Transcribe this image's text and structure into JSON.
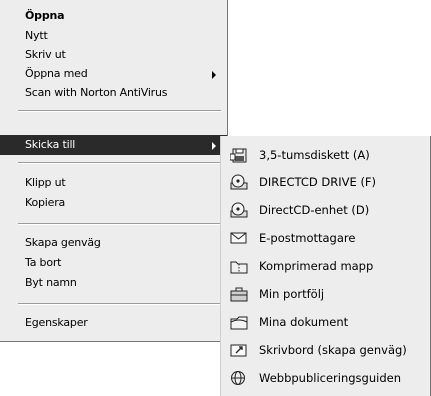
{
  "context_menu": {
    "items": [
      {
        "label": "Öppna"
      },
      {
        "label": "Nytt"
      },
      {
        "label": "Skriv ut"
      },
      {
        "label": "Öppna med"
      },
      {
        "label": "Scan with Norton AntiVirus"
      },
      {
        "label": "Skicka till"
      },
      {
        "label": "Klipp ut"
      },
      {
        "label": "Kopiera"
      },
      {
        "label": "Skapa genväg"
      },
      {
        "label": "Ta bort"
      },
      {
        "label": "Byt namn"
      },
      {
        "label": "Egenskaper"
      }
    ]
  },
  "submenu": {
    "items": [
      {
        "label": "3,5-tumsdiskett (A)",
        "icon": "floppy-disk-icon"
      },
      {
        "label": "DIRECTCD DRIVE (F)",
        "icon": "cd-drive-icon"
      },
      {
        "label": "DirectCD-enhet (D)",
        "icon": "cd-drive-icon"
      },
      {
        "label": "E-postmottagare",
        "icon": "mail-envelope-icon"
      },
      {
        "label": "Komprimerad mapp",
        "icon": "zip-folder-icon"
      },
      {
        "label": "Min portfölj",
        "icon": "briefcase-icon"
      },
      {
        "label": "Mina dokument",
        "icon": "documents-folder-icon"
      },
      {
        "label": "Skrivbord (skapa genväg)",
        "icon": "desktop-shortcut-icon"
      },
      {
        "label": "Webbpubliceringsguiden",
        "icon": "web-publishing-icon"
      }
    ]
  }
}
